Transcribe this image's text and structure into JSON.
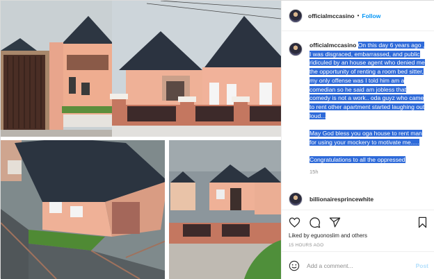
{
  "post": {
    "username": "officialmccasino",
    "follow_label": "Follow",
    "caption": {
      "username": "officialmccasino",
      "paragraph_1": "On this day 6 years ago , I was disgraced, embarrassed, and public ridiculed by an house agent who denied me the opportunity of renting a room bed sitter, my only offense was I told him am a comedian so he said am jobless that comedy is not a work.. oda guyz who came to rent other apartment started laughing out loud...",
      "paragraph_2": "May God bless you oga house to rent man for using your mockery to motivate me.....",
      "paragraph_3": "Congratulations to all the oppressed",
      "time": "15h"
    },
    "reply_username": "billionairesprincewhite",
    "likes_text": "Liked by eguonoslim and others",
    "timestamp": "15 HOURS AGO"
  },
  "comment_box": {
    "placeholder": "Add a comment...",
    "post_label": "Post"
  },
  "colors": {
    "link": "#0095f6",
    "selection": "#2e6ad9",
    "muted": "#8e8e8e"
  },
  "icons": [
    "heart-icon",
    "comment-icon",
    "share-icon",
    "bookmark-icon",
    "emoji-icon"
  ]
}
